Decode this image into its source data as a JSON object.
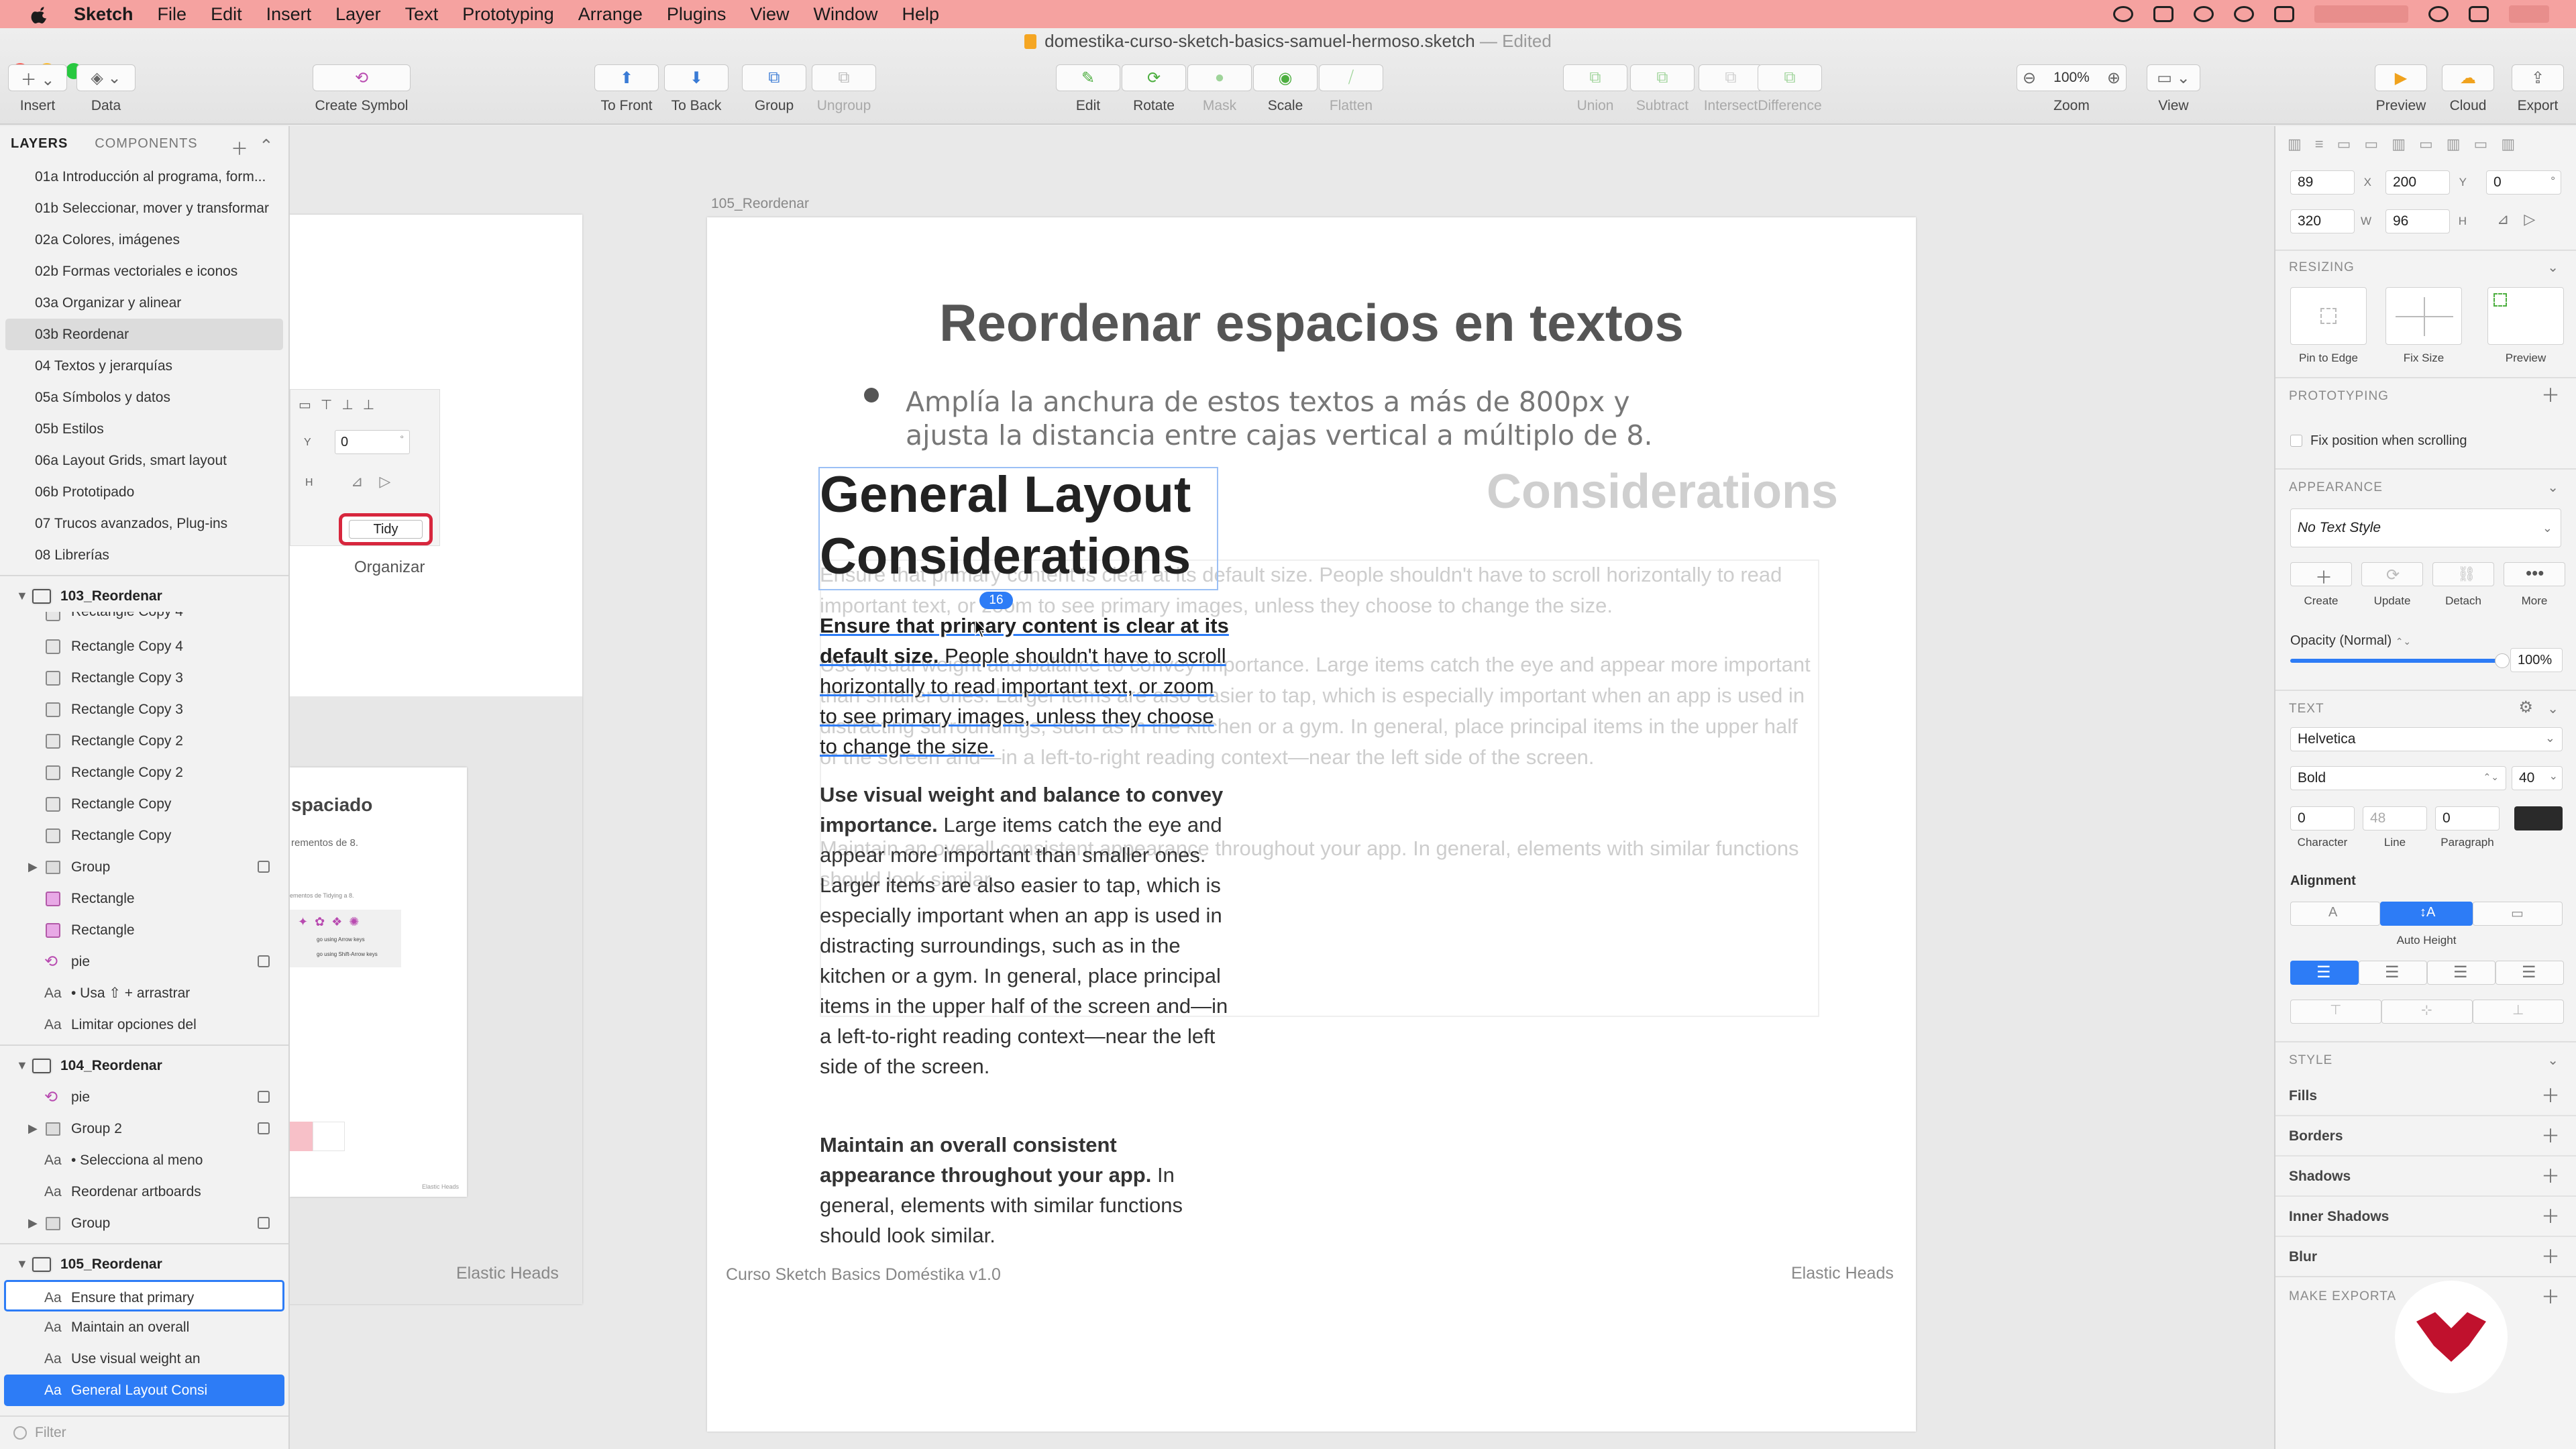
{
  "menubar": {
    "items": [
      "Sketch",
      "File",
      "Edit",
      "Insert",
      "Layer",
      "Text",
      "Prototyping",
      "Arrange",
      "Plugins",
      "View",
      "Window",
      "Help"
    ]
  },
  "window": {
    "title": "domestika-curso-sketch-basics-samuel-hermoso.sketch",
    "edited": "— Edited"
  },
  "toolbar": {
    "insert": "Insert",
    "data": "Data",
    "create_symbol": "Create Symbol",
    "to_front": "To Front",
    "to_back": "To Back",
    "group": "Group",
    "ungroup": "Ungroup",
    "edit": "Edit",
    "rotate": "Rotate",
    "mask": "Mask",
    "scale": "Scale",
    "flatten": "Flatten",
    "union": "Union",
    "subtract": "Subtract",
    "intersect": "Intersect",
    "difference": "Difference",
    "zoom_value": "100%",
    "zoom": "Zoom",
    "view": "View",
    "preview": "Preview",
    "cloud": "Cloud",
    "export": "Export"
  },
  "sidebar": {
    "tab_layers": "LAYERS",
    "tab_components": "COMPONENTS",
    "pages": [
      "01a Introducción al programa, form...",
      "01b Seleccionar, mover y transformar",
      "02a Colores, imágenes",
      "02b Formas vectoriales e iconos",
      "03a Organizar y alinear",
      "03b Reordenar",
      "04 Textos y jerarquías",
      "05a Símbolos y datos",
      "05b Estilos",
      "06a Layout Grids, smart layout",
      "06b Prototipado",
      "07 Trucos avanzados, Plug-ins",
      "08 Librerías"
    ],
    "layers": [
      {
        "name": "103_Reordenar"
      },
      {
        "name": "Rectangle Copy 4"
      },
      {
        "name": "Rectangle Copy 4"
      },
      {
        "name": "Rectangle Copy 3"
      },
      {
        "name": "Rectangle Copy 3"
      },
      {
        "name": "Rectangle Copy 2"
      },
      {
        "name": "Rectangle Copy 2"
      },
      {
        "name": "Rectangle Copy"
      },
      {
        "name": "Rectangle Copy"
      },
      {
        "name": "Group"
      },
      {
        "name": "Rectangle"
      },
      {
        "name": "Rectangle"
      },
      {
        "name": "pie"
      },
      {
        "name": "• Usa ⇧ + arrastrar"
      },
      {
        "name": "Limitar opciones del"
      },
      {
        "name": "104_Reordenar"
      },
      {
        "name": "pie"
      },
      {
        "name": "Group 2"
      },
      {
        "name": "• Selecciona al meno"
      },
      {
        "name": "Reordenar artboards"
      },
      {
        "name": "Group"
      },
      {
        "name": "105_Reordenar"
      },
      {
        "name": "Ensure that primary"
      },
      {
        "name": "Maintain an overall"
      },
      {
        "name": "Use visual weight an"
      },
      {
        "name": "General Layout Consi"
      }
    ],
    "filter_placeholder": "Filter"
  },
  "canvas": {
    "left_artboard": {
      "tidy": "Tidy",
      "organizar": "Organizar",
      "field_y": "Y",
      "field_h": "H",
      "value_zero": "0",
      "degree": "°",
      "thumb_title": "spaciado",
      "thumb_sub": "rementos de 8.",
      "thumb_caption": "ementos de Tidying a 8.",
      "thumb_r1": "go using Arrow keys",
      "thumb_r2": "go using Shift-Arrow keys",
      "thumb_logo": "Elastic Heads",
      "footer_right": "Elastic Heads"
    },
    "main_artboard": {
      "label": "105_Reordenar",
      "heading": "Reordenar espacios en textos",
      "bullet": "Amplía la anchura de estos textos a más de 800px y ajusta la distancia entre cajas vertical a múltiplo de 8.",
      "title_dark": "General Layout",
      "title_ghost": "Considerations",
      "title_line2": "Considerations",
      "badge": "16",
      "p1_bold": "Ensure that primary content is clear at its default size.",
      "p1_rest": "People shouldn't have to scroll horizontally to read important text, or zoom to see primary images, unless they choose to change the size.",
      "p2_bold": "Use visual weight and balance to convey importance.",
      "p2_rest": "Large items catch the eye and appear more important than smaller ones. Larger items are also easier to tap, which is especially important when an app is used in distracting surroundings, such as in the kitchen or a gym. In general, place principal items in the upper half of the screen and—in a left-to-right reading context—near the left side of the screen.",
      "p3_bold": "Maintain an overall consistent appearance throughout your app.",
      "p3_rest": "In general, elements with similar functions should look similar.",
      "ghost1": "Ensure that primary content is clear at its default size. People shouldn't have to scroll horizontally to read important text, or zoom to see primary images, unless they choose to change the size.",
      "ghost2": "Use visual weight and balance to convey importance. Large items catch the eye and appear more important than smaller ones. Larger items are also easier to tap, which is especially important when an app is used in distracting surroundings, such as in the kitchen or a gym. In general, place principal items in the upper half of the screen and—in a left-to-right reading context—near the left side of the screen.",
      "ghost3": "Maintain an overall consistent appearance throughout your app. In general, elements with similar functions should look similar.",
      "footer_left": "Curso Sketch Basics Doméstika v1.0",
      "footer_right": "Elastic Heads"
    }
  },
  "inspector": {
    "x": "89",
    "x_lbl": "X",
    "y": "200",
    "y_lbl": "Y",
    "rot": "0",
    "deg": "°",
    "w": "320",
    "w_lbl": "W",
    "h": "96",
    "h_lbl": "H",
    "resizing": "RESIZING",
    "pin_to_edge": "Pin to Edge",
    "fix_size": "Fix Size",
    "preview": "Preview",
    "prototyping": "PROTOTYPING",
    "fix_position": "Fix position when scrolling",
    "appearance": "APPEARANCE",
    "no_text_style": "No Text Style",
    "create": "Create",
    "update": "Update",
    "detach": "Detach",
    "more": "More",
    "opacity_label": "Opacity (Normal)",
    "opacity_value": "100%",
    "opacity": 1.0,
    "text": "TEXT",
    "font": "Helvetica",
    "weight": "Bold",
    "size": "40",
    "character": "0",
    "line": "48",
    "paragraph": "0",
    "character_lbl": "Character",
    "line_lbl": "Line",
    "paragraph_lbl": "Paragraph",
    "text_color": "#2a2a2a",
    "alignment": "Alignment",
    "auto_height": "Auto Height",
    "style": "STYLE",
    "fills": "Fills",
    "borders": "Borders",
    "shadows": "Shadows",
    "inner_shadows": "Inner Shadows",
    "blur": "Blur",
    "make_exportable": "MAKE EXPORTA"
  },
  "colors": {
    "accent": "#2d7cf6",
    "menubar": "#f5a2a0",
    "brand": "#c0112d"
  }
}
